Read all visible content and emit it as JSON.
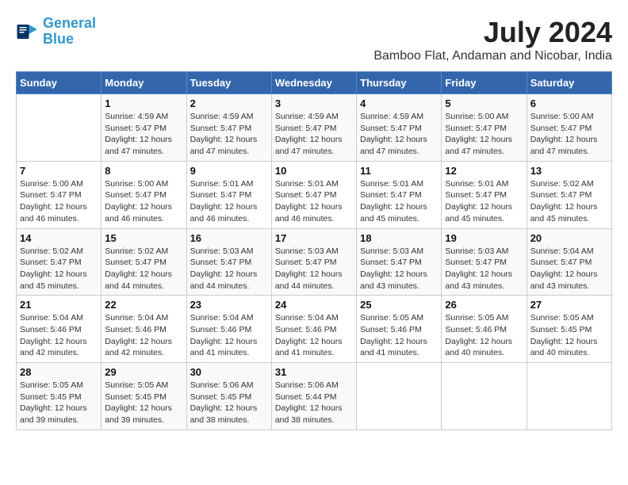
{
  "header": {
    "logo_line1": "General",
    "logo_line2": "Blue",
    "title": "July 2024",
    "subtitle": "Bamboo Flat, Andaman and Nicobar, India"
  },
  "weekdays": [
    "Sunday",
    "Monday",
    "Tuesday",
    "Wednesday",
    "Thursday",
    "Friday",
    "Saturday"
  ],
  "weeks": [
    [
      {
        "day": "",
        "info": ""
      },
      {
        "day": "1",
        "info": "Sunrise: 4:59 AM\nSunset: 5:47 PM\nDaylight: 12 hours\nand 47 minutes."
      },
      {
        "day": "2",
        "info": "Sunrise: 4:59 AM\nSunset: 5:47 PM\nDaylight: 12 hours\nand 47 minutes."
      },
      {
        "day": "3",
        "info": "Sunrise: 4:59 AM\nSunset: 5:47 PM\nDaylight: 12 hours\nand 47 minutes."
      },
      {
        "day": "4",
        "info": "Sunrise: 4:59 AM\nSunset: 5:47 PM\nDaylight: 12 hours\nand 47 minutes."
      },
      {
        "day": "5",
        "info": "Sunrise: 5:00 AM\nSunset: 5:47 PM\nDaylight: 12 hours\nand 47 minutes."
      },
      {
        "day": "6",
        "info": "Sunrise: 5:00 AM\nSunset: 5:47 PM\nDaylight: 12 hours\nand 47 minutes."
      }
    ],
    [
      {
        "day": "7",
        "info": "Sunrise: 5:00 AM\nSunset: 5:47 PM\nDaylight: 12 hours\nand 46 minutes."
      },
      {
        "day": "8",
        "info": "Sunrise: 5:00 AM\nSunset: 5:47 PM\nDaylight: 12 hours\nand 46 minutes."
      },
      {
        "day": "9",
        "info": "Sunrise: 5:01 AM\nSunset: 5:47 PM\nDaylight: 12 hours\nand 46 minutes."
      },
      {
        "day": "10",
        "info": "Sunrise: 5:01 AM\nSunset: 5:47 PM\nDaylight: 12 hours\nand 46 minutes."
      },
      {
        "day": "11",
        "info": "Sunrise: 5:01 AM\nSunset: 5:47 PM\nDaylight: 12 hours\nand 45 minutes."
      },
      {
        "day": "12",
        "info": "Sunrise: 5:01 AM\nSunset: 5:47 PM\nDaylight: 12 hours\nand 45 minutes."
      },
      {
        "day": "13",
        "info": "Sunrise: 5:02 AM\nSunset: 5:47 PM\nDaylight: 12 hours\nand 45 minutes."
      }
    ],
    [
      {
        "day": "14",
        "info": "Sunrise: 5:02 AM\nSunset: 5:47 PM\nDaylight: 12 hours\nand 45 minutes."
      },
      {
        "day": "15",
        "info": "Sunrise: 5:02 AM\nSunset: 5:47 PM\nDaylight: 12 hours\nand 44 minutes."
      },
      {
        "day": "16",
        "info": "Sunrise: 5:03 AM\nSunset: 5:47 PM\nDaylight: 12 hours\nand 44 minutes."
      },
      {
        "day": "17",
        "info": "Sunrise: 5:03 AM\nSunset: 5:47 PM\nDaylight: 12 hours\nand 44 minutes."
      },
      {
        "day": "18",
        "info": "Sunrise: 5:03 AM\nSunset: 5:47 PM\nDaylight: 12 hours\nand 43 minutes."
      },
      {
        "day": "19",
        "info": "Sunrise: 5:03 AM\nSunset: 5:47 PM\nDaylight: 12 hours\nand 43 minutes."
      },
      {
        "day": "20",
        "info": "Sunrise: 5:04 AM\nSunset: 5:47 PM\nDaylight: 12 hours\nand 43 minutes."
      }
    ],
    [
      {
        "day": "21",
        "info": "Sunrise: 5:04 AM\nSunset: 5:46 PM\nDaylight: 12 hours\nand 42 minutes."
      },
      {
        "day": "22",
        "info": "Sunrise: 5:04 AM\nSunset: 5:46 PM\nDaylight: 12 hours\nand 42 minutes."
      },
      {
        "day": "23",
        "info": "Sunrise: 5:04 AM\nSunset: 5:46 PM\nDaylight: 12 hours\nand 41 minutes."
      },
      {
        "day": "24",
        "info": "Sunrise: 5:04 AM\nSunset: 5:46 PM\nDaylight: 12 hours\nand 41 minutes."
      },
      {
        "day": "25",
        "info": "Sunrise: 5:05 AM\nSunset: 5:46 PM\nDaylight: 12 hours\nand 41 minutes."
      },
      {
        "day": "26",
        "info": "Sunrise: 5:05 AM\nSunset: 5:46 PM\nDaylight: 12 hours\nand 40 minutes."
      },
      {
        "day": "27",
        "info": "Sunrise: 5:05 AM\nSunset: 5:45 PM\nDaylight: 12 hours\nand 40 minutes."
      }
    ],
    [
      {
        "day": "28",
        "info": "Sunrise: 5:05 AM\nSunset: 5:45 PM\nDaylight: 12 hours\nand 39 minutes."
      },
      {
        "day": "29",
        "info": "Sunrise: 5:05 AM\nSunset: 5:45 PM\nDaylight: 12 hours\nand 39 minutes."
      },
      {
        "day": "30",
        "info": "Sunrise: 5:06 AM\nSunset: 5:45 PM\nDaylight: 12 hours\nand 38 minutes."
      },
      {
        "day": "31",
        "info": "Sunrise: 5:06 AM\nSunset: 5:44 PM\nDaylight: 12 hours\nand 38 minutes."
      },
      {
        "day": "",
        "info": ""
      },
      {
        "day": "",
        "info": ""
      },
      {
        "day": "",
        "info": ""
      }
    ]
  ]
}
